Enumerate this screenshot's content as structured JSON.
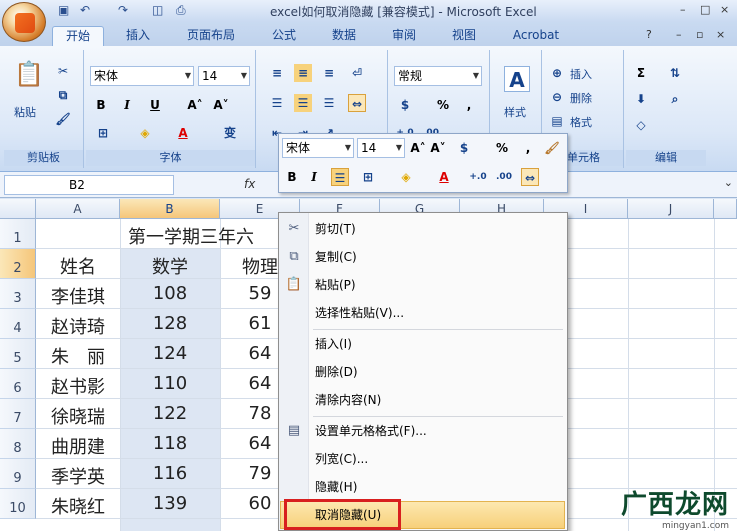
{
  "window": {
    "title": "excel如何取消隐藏 [兼容模式] - Microsoft Excel",
    "controls": [
      "–",
      "□",
      "×"
    ]
  },
  "ribbon_tabs": [
    "开始",
    "插入",
    "页面布局",
    "公式",
    "数据",
    "审阅",
    "视图",
    "Acrobat"
  ],
  "active_tab": "开始",
  "ribbon": {
    "clipboard": {
      "paste": "粘贴",
      "label": "剪贴板"
    },
    "font": {
      "name": "宋体",
      "size": "14",
      "label": "字体",
      "bold": "B",
      "italic": "I",
      "underline": "U",
      "phonetic": "变"
    },
    "number": {
      "format": "常规",
      "percent": "%",
      "comma": ","
    },
    "styles": {
      "label": "样式"
    },
    "cells": {
      "insert": "插入",
      "delete": "删除",
      "format": "格式",
      "label": "单元格"
    },
    "editing": {
      "sum": "Σ",
      "label": "编辑"
    }
  },
  "formula_bar": {
    "name_box": "B2",
    "fx": "fx"
  },
  "columns": [
    "A",
    "B",
    "E",
    "F",
    "G",
    "H",
    "I",
    "J"
  ],
  "rows": [
    {
      "num": "1",
      "a": "",
      "b": "第一学期三年六",
      "e": ""
    },
    {
      "num": "2",
      "a": "姓名",
      "b": "数学",
      "e": "物理"
    },
    {
      "num": "3",
      "a": "李佳琪",
      "b": "108",
      "e": "59"
    },
    {
      "num": "4",
      "a": "赵诗琦",
      "b": "128",
      "e": "61"
    },
    {
      "num": "5",
      "a": "朱　丽",
      "b": "124",
      "e": "64"
    },
    {
      "num": "6",
      "a": "赵书影",
      "b": "110",
      "e": "64"
    },
    {
      "num": "7",
      "a": "徐晓瑞",
      "b": "122",
      "e": "78"
    },
    {
      "num": "8",
      "a": "曲朋建",
      "b": "118",
      "e": "64"
    },
    {
      "num": "9",
      "a": "季学英",
      "b": "116",
      "e": "79"
    },
    {
      "num": "10",
      "a": "朱晓红",
      "b": "139",
      "e": "60"
    }
  ],
  "mini_toolbar": {
    "font": "宋体",
    "size": "14",
    "percent": "%",
    "comma": ",",
    "bold": "B",
    "italic": "I"
  },
  "context_menu": [
    {
      "label": "剪切(T)",
      "icon": "scissors-icon"
    },
    {
      "label": "复制(C)",
      "icon": "copy-icon"
    },
    {
      "label": "粘贴(P)",
      "icon": "paste-icon"
    },
    {
      "label": "选择性粘贴(V)...",
      "icon": ""
    },
    {
      "label": "插入(I)",
      "icon": ""
    },
    {
      "label": "删除(D)",
      "icon": ""
    },
    {
      "label": "清除内容(N)",
      "icon": ""
    },
    {
      "label": "设置单元格格式(F)...",
      "icon": "format-cells-icon"
    },
    {
      "label": "列宽(C)...",
      "icon": ""
    },
    {
      "label": "隐藏(H)",
      "icon": ""
    },
    {
      "label": "取消隐藏(U)",
      "icon": ""
    }
  ],
  "watermark": {
    "text": "广西龙网",
    "url": "mingyan1.com"
  }
}
